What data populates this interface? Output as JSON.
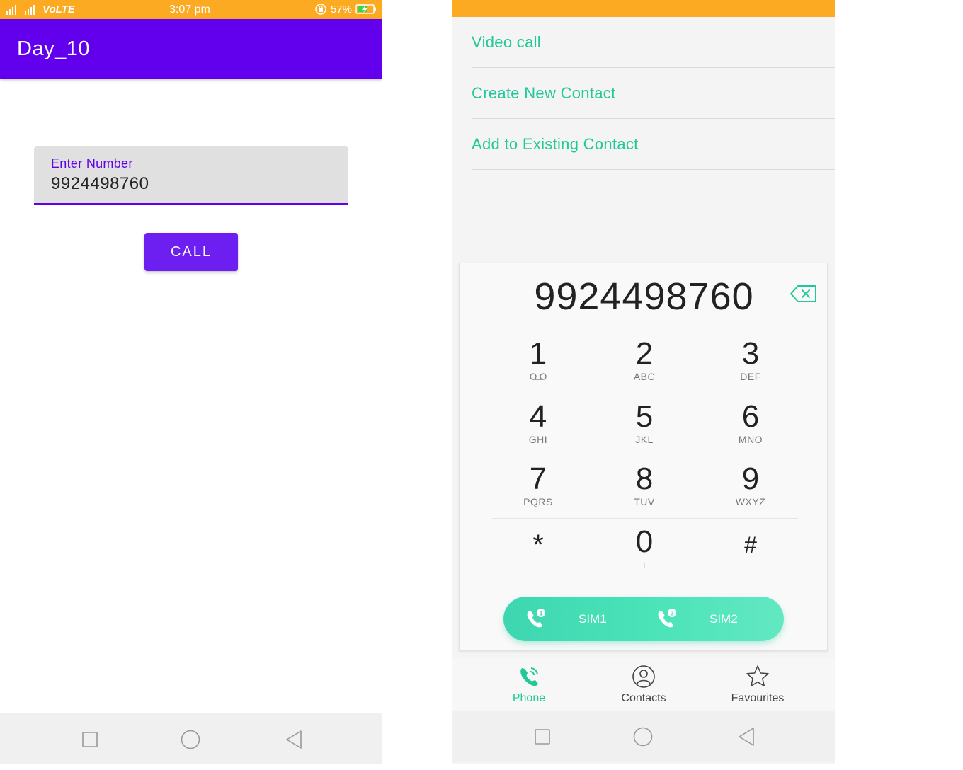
{
  "left_screen": {
    "status_bar": {
      "network": "VoLTE",
      "time": "3:07 pm",
      "battery": "57%"
    },
    "app_bar": {
      "title": "Day_10"
    },
    "number_field": {
      "label": "Enter Number",
      "value": "9924498760"
    },
    "call_button": {
      "label": "CALL"
    },
    "colors": {
      "primary": "#6200ee",
      "status_bar": "#fbaa21"
    }
  },
  "right_screen": {
    "menu": [
      {
        "label": "Video call"
      },
      {
        "label": "Create New Contact"
      },
      {
        "label": "Add to Existing Contact"
      }
    ],
    "dialed_number": "9924498760",
    "keys": [
      {
        "digit": "1",
        "letters": "",
        "icon": "voicemail-icon"
      },
      {
        "digit": "2",
        "letters": "ABC"
      },
      {
        "digit": "3",
        "letters": "DEF"
      },
      {
        "digit": "4",
        "letters": "GHI"
      },
      {
        "digit": "5",
        "letters": "JKL"
      },
      {
        "digit": "6",
        "letters": "MNO"
      },
      {
        "digit": "7",
        "letters": "PQRS"
      },
      {
        "digit": "8",
        "letters": "TUV"
      },
      {
        "digit": "9",
        "letters": "WXYZ"
      },
      {
        "digit": "*",
        "letters": ""
      },
      {
        "digit": "0",
        "letters": "+"
      },
      {
        "digit": "#",
        "letters": ""
      }
    ],
    "sim_buttons": [
      {
        "label": "SIM1",
        "badge": "1"
      },
      {
        "label": "SIM2",
        "badge": "2"
      }
    ],
    "tabs": [
      {
        "label": "Phone",
        "icon": "phone-icon",
        "active": true
      },
      {
        "label": "Contacts",
        "icon": "contacts-icon",
        "active": false
      },
      {
        "label": "Favourites",
        "icon": "star-icon",
        "active": false
      }
    ],
    "colors": {
      "accent": "#20c997",
      "status_bar": "#fbaa21"
    }
  }
}
